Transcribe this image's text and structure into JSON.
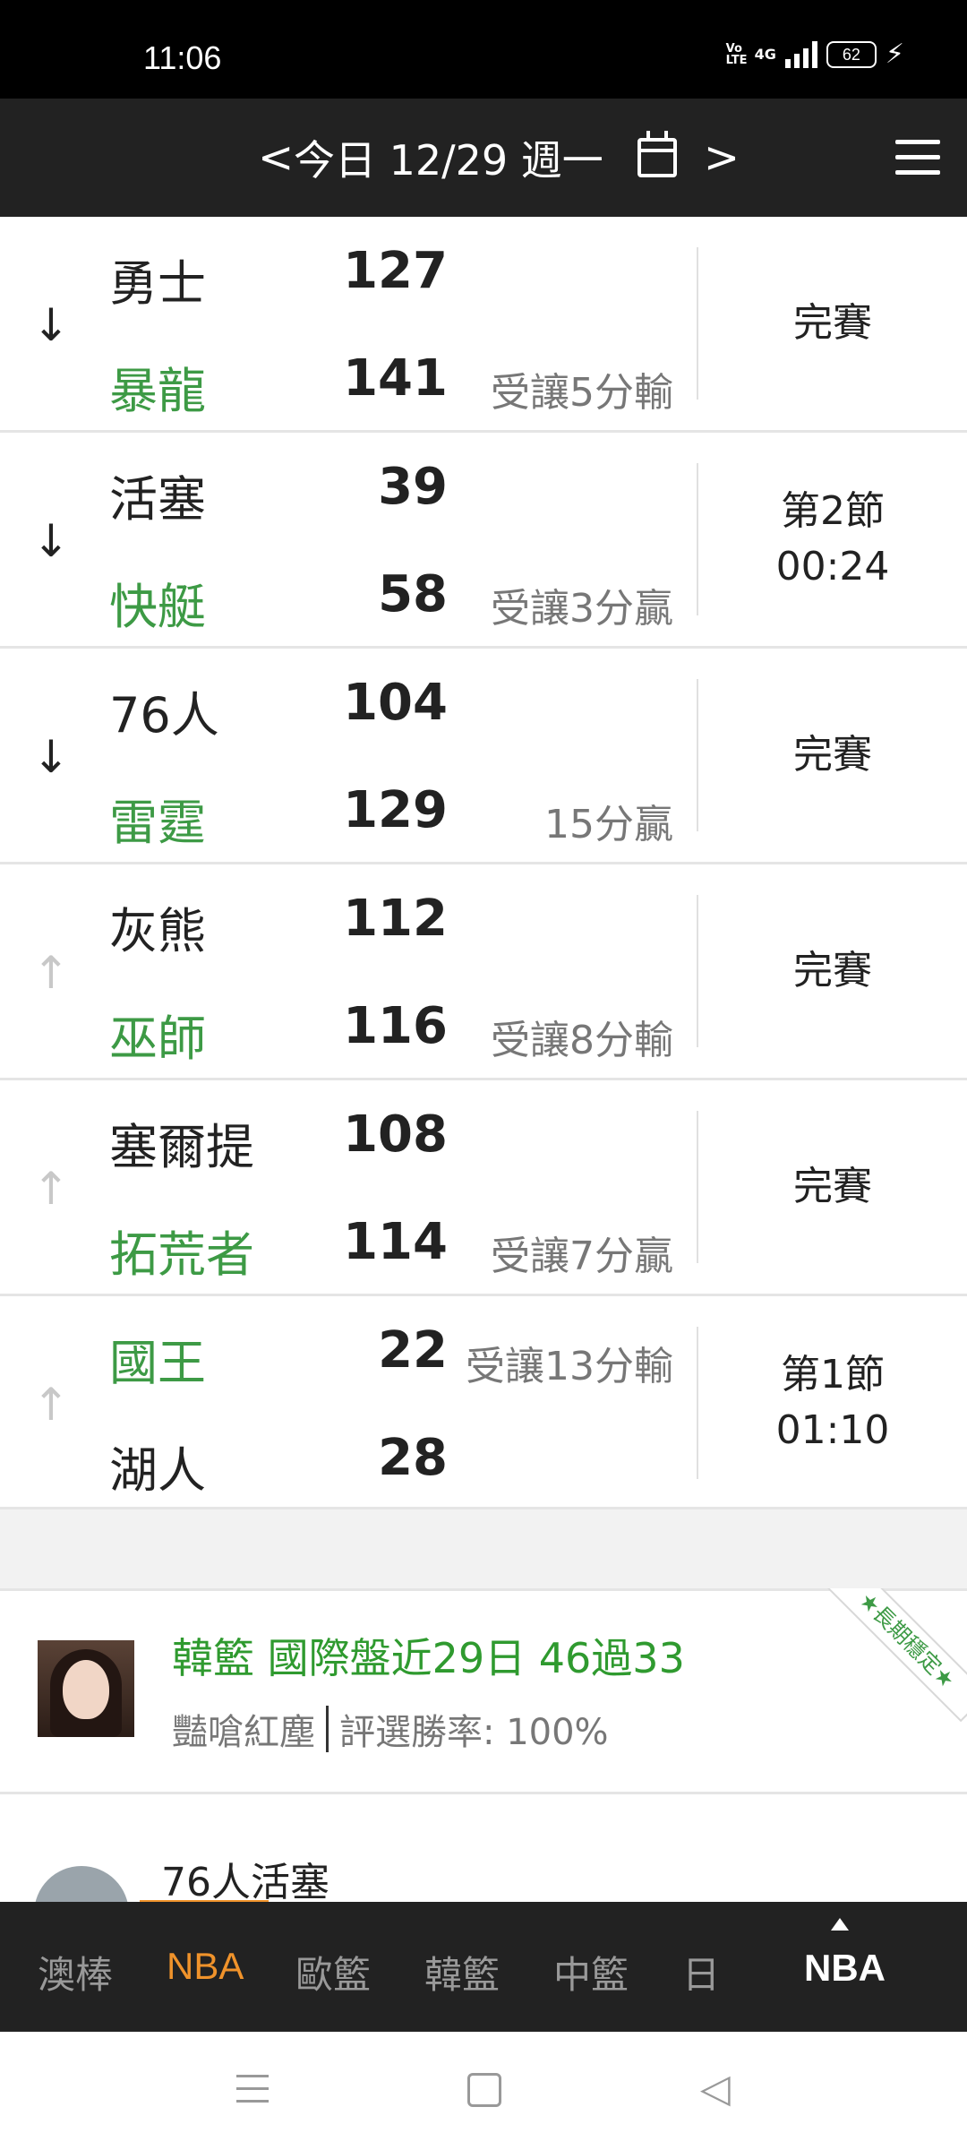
{
  "status_bar": {
    "time": "11:06",
    "volte": "Vo LTE",
    "network": "4G",
    "battery": "62"
  },
  "header": {
    "prev": "<",
    "date": "今日 12/29 週一",
    "next": ">"
  },
  "games": [
    {
      "arrow": "↓",
      "team1": "勇士",
      "team2": "暴龍",
      "score1": "127",
      "score2": "141",
      "odds1": "",
      "odds2": "受讓5分輸",
      "status": [
        "完賽"
      ]
    },
    {
      "arrow": "↓",
      "team1": "活塞",
      "team2": "快艇",
      "score1": "39",
      "score2": "58",
      "odds1": "",
      "odds2": "受讓3分贏",
      "status": [
        "第2節",
        "00:24"
      ]
    },
    {
      "arrow": "↓",
      "team1": "76人",
      "team2": "雷霆",
      "score1": "104",
      "score2": "129",
      "odds1": "",
      "odds2": "15分贏",
      "status": [
        "完賽"
      ]
    },
    {
      "arrow": "↑",
      "team1": "灰熊",
      "team2": "巫師",
      "score1": "112",
      "score2": "116",
      "odds1": "",
      "odds2": "受讓8分輸",
      "status": [
        "完賽"
      ]
    },
    {
      "arrow": "↑",
      "team1": "塞爾提",
      "team2": "拓荒者",
      "score1": "108",
      "score2": "114",
      "odds1": "",
      "odds2": "受讓7分贏",
      "status": [
        "完賽"
      ]
    },
    {
      "arrow": "↑",
      "team1": "國王",
      "team2": "湖人",
      "score1": "22",
      "score2": "28",
      "odds1": "受讓13分輸",
      "odds2": "",
      "status": [
        "第1節",
        "01:10"
      ]
    }
  ],
  "promo": {
    "title": "韓籃 國際盤近29日 46過33",
    "author": "豔嗆紅塵",
    "win_rate": "評選勝率: 100%",
    "ribbon": "★長期穩定★"
  },
  "next_item": {
    "title": "76人活塞"
  },
  "bottom_tabs": [
    "澳棒",
    "NBA",
    "歐籃",
    "韓籃",
    "中籃",
    "日"
  ],
  "bottom_big_tab": "NBA",
  "colors": {
    "green": "#3d9a45",
    "orange": "#f0932b",
    "header_bg": "#222222"
  }
}
